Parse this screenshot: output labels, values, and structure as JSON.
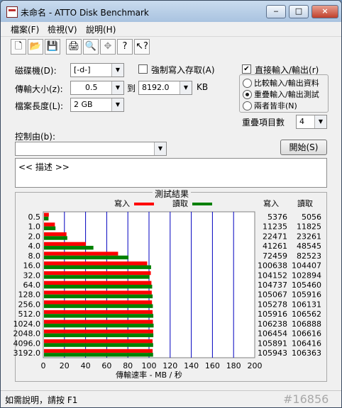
{
  "window": {
    "title": "未命名 - ATTO Disk Benchmark",
    "minimize": "‒",
    "maximize": "□",
    "close": "×"
  },
  "menu": [
    "檔案(F)",
    "檢視(V)",
    "說明(H)"
  ],
  "toolbar": [
    "🗋",
    "📂",
    "💾",
    "🖨",
    "🔍",
    "✥",
    "?",
    "↖?"
  ],
  "settings": {
    "drive_label": "磁碟機(D):",
    "drive_value": "[-d-]",
    "force_write_label": "強制寫入存取(A)",
    "force_write_checked": false,
    "direct_io_label": "直接輸入/輸出(r)",
    "direct_io_checked": true,
    "transfer_label": "傳輸大小(z):",
    "transfer_from": "0.5",
    "to_label": "到",
    "transfer_to": "8192.0",
    "kb_label": "KB",
    "length_label": "檔案長度(L):",
    "length_value": "2 GB",
    "mode_options": [
      "比較輸入/輸出資料",
      "重疊輸入/輸出測試",
      "兩者皆非(N)"
    ],
    "mode_selected": 1,
    "queue_label": "重疊項目數",
    "queue_value": "4",
    "controlled_by_label": "控制由(b):",
    "controlled_by_value": "",
    "start_button": "開始(S)",
    "description_text": "<<   描述   >>"
  },
  "results": {
    "group_title": "測試結果",
    "write_legend": "寫入",
    "read_legend": "讀取",
    "write_header": "寫入",
    "read_header": "讀取",
    "write_color": "#ff0000",
    "read_color": "#008000"
  },
  "chart_data": {
    "type": "bar",
    "orientation": "horizontal",
    "categories": [
      "0.5",
      "1.0",
      "2.0",
      "4.0",
      "8.0",
      "16.0",
      "32.0",
      "64.0",
      "128.0",
      "256.0",
      "512.0",
      "1024.0",
      "2048.0",
      "4096.0",
      "3192.0"
    ],
    "series": [
      {
        "name": "寫入",
        "values": [
          5376,
          11235,
          22471,
          41261,
          72459,
          100638,
          104152,
          104737,
          105067,
          105278,
          105916,
          106238,
          106454,
          105891,
          105943
        ]
      },
      {
        "name": "讀取",
        "values": [
          5056,
          11825,
          23261,
          48545,
          82523,
          104407,
          102894,
          105460,
          105916,
          106131,
          106562,
          106888,
          106616,
          106416,
          106363
        ]
      }
    ],
    "xlabel": "傳輸速率 - MB / 秒",
    "xlim": [
      0,
      200
    ],
    "xticks": [
      "0",
      "20",
      "40",
      "60",
      "80",
      "100",
      "120",
      "140",
      "160",
      "180",
      "200"
    ],
    "grid": true
  },
  "statusbar": {
    "help_text": "如需說明，請按 F1",
    "watermark": "#16856"
  }
}
